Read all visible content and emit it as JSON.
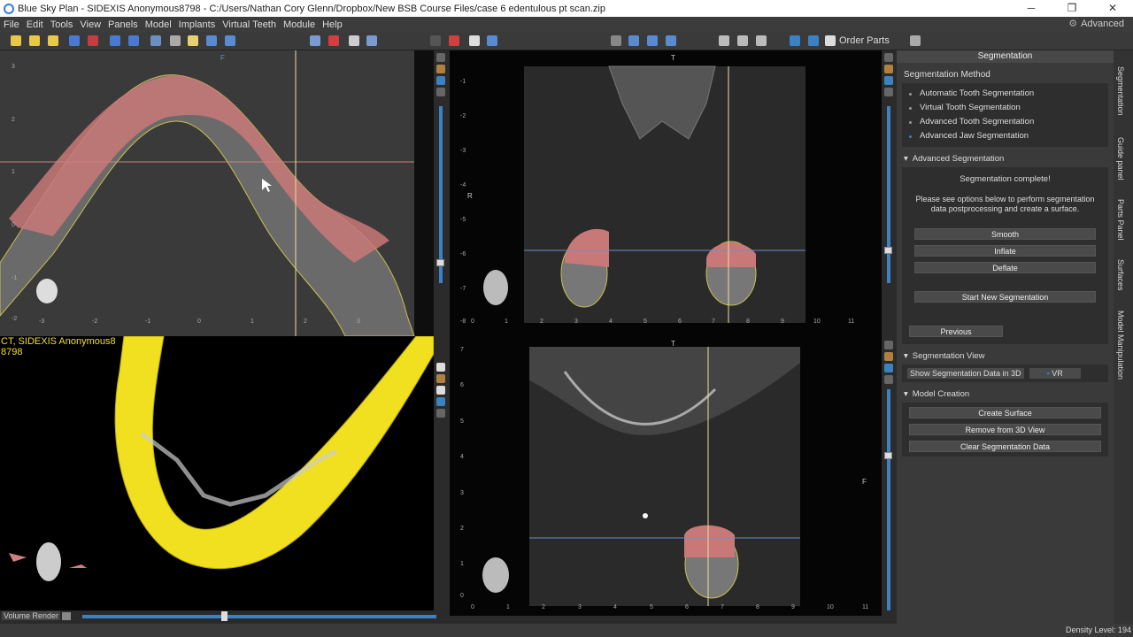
{
  "window": {
    "title": "Blue Sky Plan - SIDEXIS Anonymous8798 - C:/Users/Nathan Cory Glenn/Dropbox/New BSB Course Files/case 6 edentulous pt scan.zip",
    "minimize": "─",
    "restore": "❐",
    "close": "✕"
  },
  "menu": {
    "items": [
      "File",
      "Edit",
      "Tools",
      "View",
      "Panels",
      "Model",
      "Implants",
      "Virtual Teeth",
      "Module",
      "Help"
    ],
    "advanced_label": "Advanced"
  },
  "toolbar": {
    "order_parts_label": "Order Parts"
  },
  "viewports": {
    "axial": {
      "top_label": "F"
    },
    "coronal": {
      "top_label": "T",
      "left_label": "R"
    },
    "volume": {
      "overlay_line1": "CT, SIDEXIS Anonymous8",
      "overlay_line2": "8798",
      "render_label": "Volume Render",
      "slider_value": 0.5
    },
    "sagittal": {
      "top_label": "T",
      "right_label": "F"
    }
  },
  "ticks": {
    "axial_x": [
      "-3",
      "-2",
      "-1",
      "0",
      "1",
      "2",
      "3"
    ],
    "axial_y": [
      "3",
      "2",
      "1",
      "0",
      "-1",
      "-2"
    ],
    "coronal_x": [
      "0",
      "1",
      "2",
      "3",
      "4",
      "5",
      "6",
      "7",
      "8",
      "9",
      "10",
      "11"
    ],
    "coronal_y": [
      "-1",
      "-2",
      "-3",
      "-4",
      "-5",
      "-6",
      "-7",
      "-8"
    ],
    "sagittal_x": [
      "0",
      "1",
      "2",
      "3",
      "4",
      "5",
      "6",
      "7",
      "8",
      "9",
      "10",
      "11"
    ],
    "sagittal_y": [
      "7",
      "6",
      "5",
      "4",
      "3",
      "2",
      "1",
      "0"
    ]
  },
  "panel": {
    "header": "Segmentation",
    "method_title": "Segmentation Method",
    "methods": [
      "Automatic Tooth Segmentation",
      "Virtual Tooth Segmentation",
      "Advanced Tooth Segmentation",
      "Advanced Jaw Segmentation"
    ],
    "advanced_title": "Advanced Segmentation",
    "complete_msg": "Segmentation complete!",
    "info_msg": "Please see options below to perform segmentation data postprocessing and create a surface.",
    "buttons": {
      "smooth": "Smooth",
      "inflate": "Inflate",
      "deflate": "Deflate",
      "start_new": "Start New Segmentation",
      "previous": "Previous"
    },
    "view_title": "Segmentation View",
    "show_3d": "Show Segmentation Data in 3D",
    "vr": "VR",
    "model_title": "Model Creation",
    "create_surface": "Create Surface",
    "remove_3d": "Remove from 3D View",
    "clear_data": "Clear Segmentation Data"
  },
  "side_tabs": [
    "Segmentation",
    "Guide panel",
    "Parts Panel",
    "Surfaces",
    "Model Manipulation"
  ],
  "status": {
    "density": "Density Level: 194"
  },
  "colors": {
    "accent": "#3b82c4",
    "segmentation": "#e07a7a",
    "surface": "#f0e020"
  }
}
